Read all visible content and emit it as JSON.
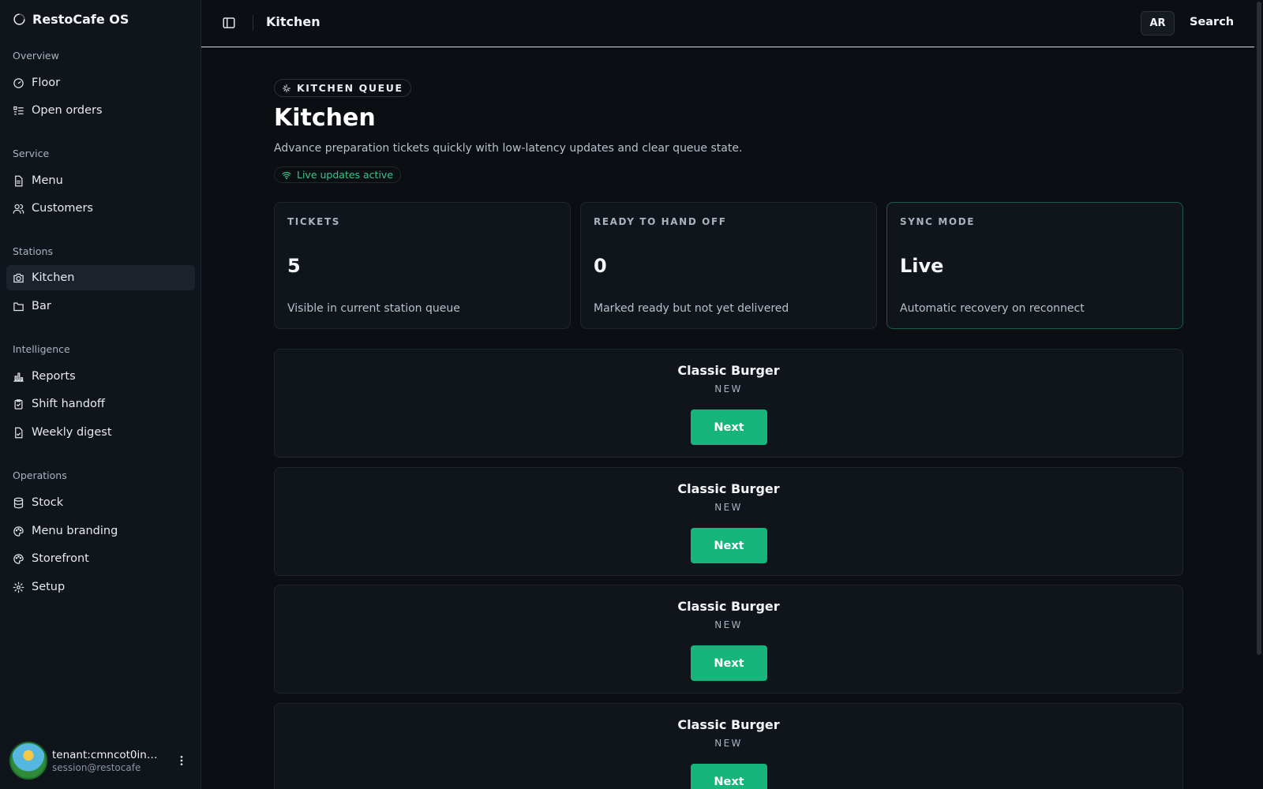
{
  "app": {
    "name": "RestoCafe OS"
  },
  "sidebar": {
    "groups": [
      {
        "label": "Overview",
        "items": [
          {
            "label": "Floor",
            "icon": "gauge-icon"
          },
          {
            "label": "Open orders",
            "icon": "list-icon"
          }
        ]
      },
      {
        "label": "Service",
        "items": [
          {
            "label": "Menu",
            "icon": "file-icon"
          },
          {
            "label": "Customers",
            "icon": "users-icon"
          }
        ]
      },
      {
        "label": "Stations",
        "items": [
          {
            "label": "Kitchen",
            "icon": "camera-icon",
            "active": true
          },
          {
            "label": "Bar",
            "icon": "folder-icon"
          }
        ]
      },
      {
        "label": "Intelligence",
        "items": [
          {
            "label": "Reports",
            "icon": "bar-chart-icon"
          },
          {
            "label": "Shift handoff",
            "icon": "clipboard-icon"
          },
          {
            "label": "Weekly digest",
            "icon": "file-text-icon"
          }
        ]
      },
      {
        "label": "Operations",
        "items": [
          {
            "label": "Stock",
            "icon": "database-icon"
          },
          {
            "label": "Menu branding",
            "icon": "palette-icon"
          },
          {
            "label": "Storefront",
            "icon": "palette-icon"
          },
          {
            "label": "Setup",
            "icon": "gear-icon"
          }
        ]
      }
    ],
    "user": {
      "name": "tenant:cmncot0in000...",
      "email": "session@restocafe"
    }
  },
  "topbar": {
    "title": "Kitchen",
    "lang": "AR",
    "search": "Search"
  },
  "main": {
    "eyebrow": "KITCHEN QUEUE",
    "title": "Kitchen",
    "description": "Advance preparation tickets quickly with low-latency updates and clear queue state.",
    "live_status": "Live updates active",
    "stats": [
      {
        "label": "TICKETS",
        "value": "5",
        "note": "Visible in current station queue"
      },
      {
        "label": "READY TO HAND OFF",
        "value": "0",
        "note": "Marked ready but not yet delivered"
      },
      {
        "label": "SYNC MODE",
        "value": "Live",
        "note": "Automatic recovery on reconnect"
      }
    ],
    "tickets": [
      {
        "name": "Classic Burger",
        "status": "NEW",
        "action": "Next"
      },
      {
        "name": "Classic Burger",
        "status": "NEW",
        "action": "Next"
      },
      {
        "name": "Classic Burger",
        "status": "NEW",
        "action": "Next"
      },
      {
        "name": "Classic Burger",
        "status": "NEW",
        "action": "Next"
      }
    ]
  },
  "colors": {
    "accent": "#16b57c",
    "live": "#34c98a",
    "background": "#0b0e13",
    "sidebar": "#10141b"
  }
}
